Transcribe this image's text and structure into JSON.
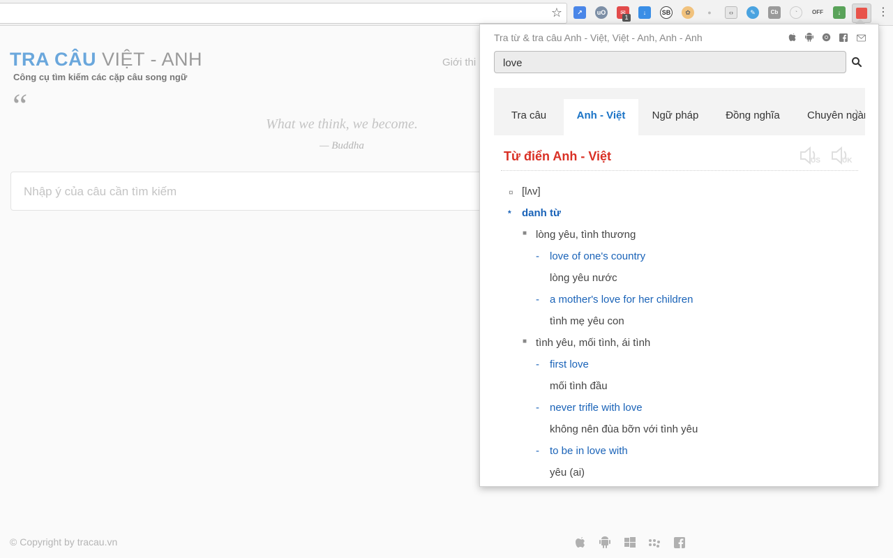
{
  "site": {
    "title_a": "TRA CÂU",
    "title_b": "VIỆT - ANH",
    "subtitle": "Công cụ tìm kiếm các cặp câu song ngữ",
    "nav_intro": "Giới thi",
    "quote": "What we think, we become.",
    "quote_author": "— Buddha",
    "search_placeholder": "Nhập ý của câu cần tìm kiếm",
    "copyright": "© Copyright by tracau.vn"
  },
  "popup": {
    "header": "Tra từ & tra câu Anh - Việt, Việt - Anh, Anh - Anh",
    "query": "love",
    "tabs": [
      {
        "label": "Tra câu",
        "active": false
      },
      {
        "label": "Anh - Việt",
        "active": true
      },
      {
        "label": "Ngữ pháp",
        "active": false
      },
      {
        "label": "Đồng nghĩa",
        "active": false
      },
      {
        "label": "Chuyên ngàn",
        "active": false
      }
    ],
    "dict_title": "Từ điển Anh - Việt",
    "speakers": [
      "US",
      "UK"
    ],
    "pronunciation": "[lʌv]",
    "pos": "danh từ",
    "senses": [
      {
        "meaning": "lòng yêu, tình thương",
        "examples": [
          {
            "en": "love of one's country",
            "vi": "lòng yêu nước"
          },
          {
            "en": "a mother's love for her children",
            "vi": "tình mẹ yêu con"
          }
        ]
      },
      {
        "meaning": "tình yêu, mối tình, ái tình",
        "examples": [
          {
            "en": "first love",
            "vi": "mối tình đầu"
          },
          {
            "en": "never trifle with love",
            "vi": "không nên đùa bỡn với tình yêu"
          },
          {
            "en": "to be in love with",
            "vi": "yêu (ai)"
          }
        ]
      }
    ]
  },
  "extensions": {
    "badge": "1",
    "off_label": "OFF"
  }
}
